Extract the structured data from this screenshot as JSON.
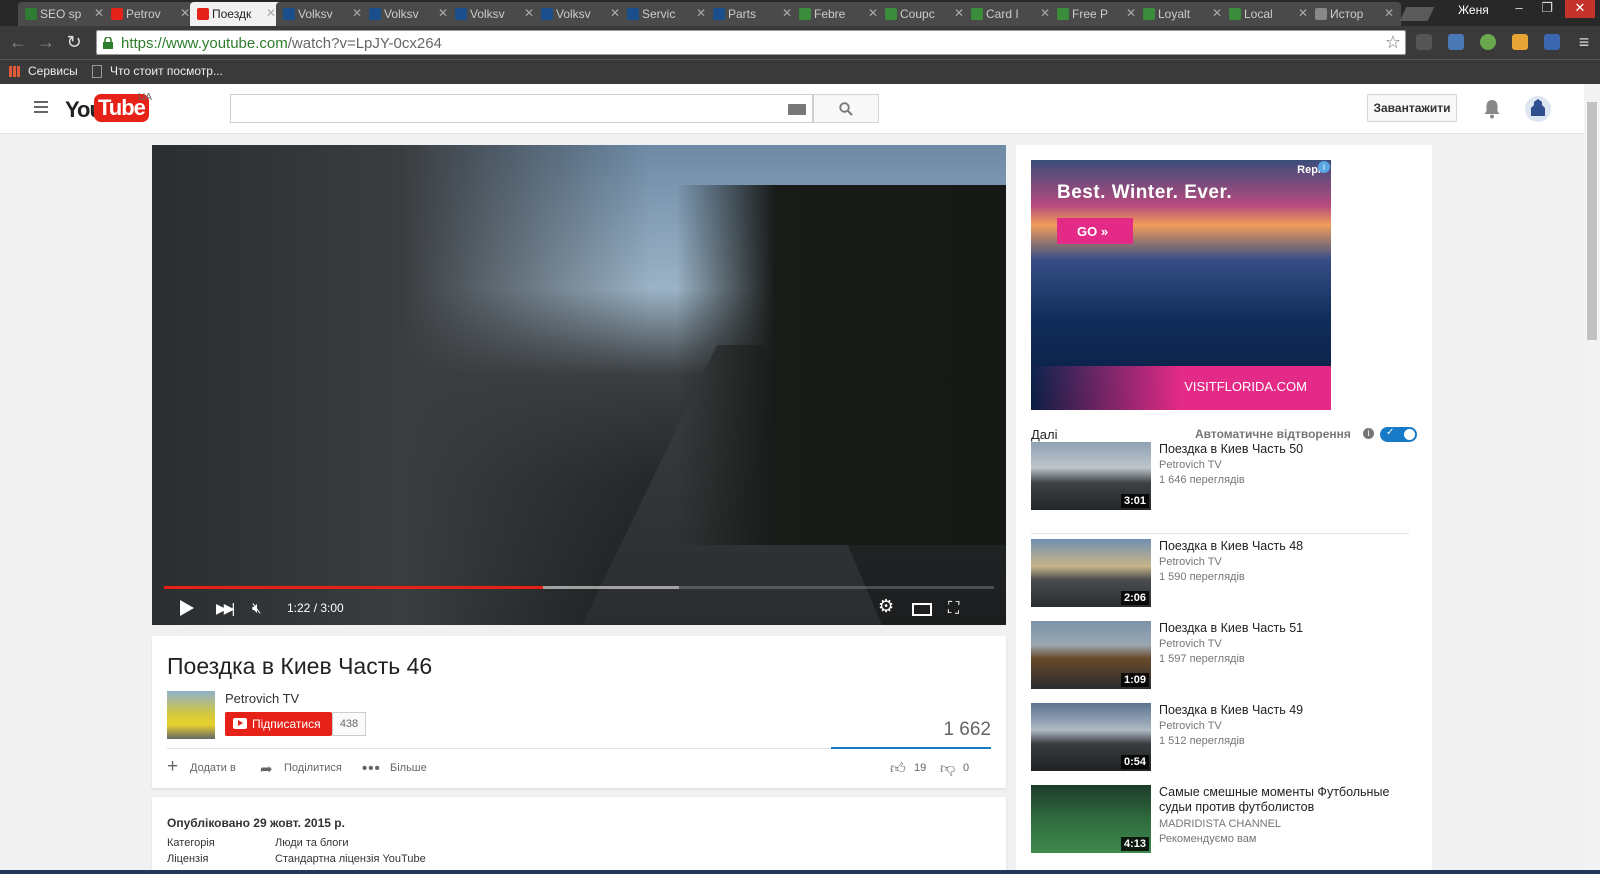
{
  "browser": {
    "tabs": [
      {
        "label": "SEO sp",
        "color": "#2e7d32"
      },
      {
        "label": "Petrov",
        "color": "#e62117"
      },
      {
        "label": "Поездк",
        "color": "#e62117",
        "active": true
      },
      {
        "label": "Volksv",
        "color": "#1b4e8c"
      },
      {
        "label": "Volksv",
        "color": "#1b4e8c"
      },
      {
        "label": "Volksv",
        "color": "#1b4e8c"
      },
      {
        "label": "Volksv",
        "color": "#1b4e8c"
      },
      {
        "label": "Servic",
        "color": "#1b4e8c"
      },
      {
        "label": "Parts",
        "color": "#1b4e8c"
      },
      {
        "label": "Febre",
        "color": "#3a8d3a"
      },
      {
        "label": "Coupc",
        "color": "#3a8d3a"
      },
      {
        "label": "Card I",
        "color": "#3a8d3a"
      },
      {
        "label": "Free P",
        "color": "#3a8d3a"
      },
      {
        "label": "Loyalt",
        "color": "#3a8d3a"
      },
      {
        "label": "Local",
        "color": "#3a8d3a"
      },
      {
        "label": "Истор",
        "color": "#888888"
      }
    ],
    "profile_name": "Женя",
    "url_host": "https://www.youtube.com",
    "url_path": "/watch?v=LpJY-0cx264",
    "bookmarks": {
      "apps": "Сервисы",
      "folder": "Что стоит посмотр..."
    }
  },
  "youtube": {
    "country": "UA",
    "upload_label": "Завантажити",
    "player": {
      "timecode": "1:22 / 3:00",
      "played_fraction": 0.457,
      "loaded_fraction": 0.62
    },
    "video": {
      "title": "Поездка в Киев Часть 46",
      "channel": "Petrovich TV",
      "subscribe_label": "Підписатися",
      "subscriber_count": "438",
      "views": "1 662",
      "add_to": "Додати в",
      "share": "Поділитися",
      "more": "Більше",
      "likes": "19",
      "dislikes": "0"
    },
    "description": {
      "published": "Опубліковано 29 жовт. 2015 р.",
      "category_label": "Категорія",
      "category_value": "Люди та блоги",
      "license_label": "Ліцензія",
      "license_value": "Стандартна ліцензія YouTube"
    },
    "ad": {
      "headline": "Best. Winter. Ever.",
      "cta": "GO »",
      "brand": "VISITFLORIDA.COM",
      "reply": "Repl"
    },
    "sidebar": {
      "next_label": "Далі",
      "autoplay_label": "Автоматичне відтворення",
      "related": [
        {
          "title": "Поездка в Киев Часть 50",
          "channel": "Petrovich TV",
          "meta": "1 646 переглядів",
          "duration": "3:01"
        },
        {
          "title": "Поездка в Киев Часть 48",
          "channel": "Petrovich TV",
          "meta": "1 590 переглядів",
          "duration": "2:06"
        },
        {
          "title": "Поездка в Киев Часть 51",
          "channel": "Petrovich TV",
          "meta": "1 597 переглядів",
          "duration": "1:09"
        },
        {
          "title": "Поездка в Киев Часть 49",
          "channel": "Petrovich TV",
          "meta": "1 512 переглядів",
          "duration": "0:54"
        },
        {
          "title": "Самые смешные моменты Футбольные судьи против футболистов",
          "channel": "MADRIDISTA CHANNEL",
          "meta": "Рекомендуємо вам",
          "duration": "4:13"
        }
      ]
    }
  }
}
